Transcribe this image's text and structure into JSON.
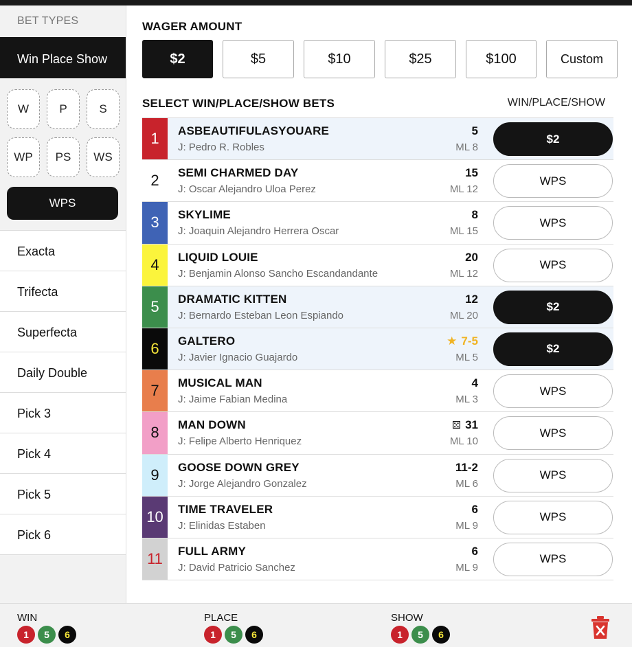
{
  "sidebar": {
    "header": "BET TYPES",
    "active": "Win Place Show",
    "sub_types": [
      "W",
      "P",
      "S",
      "WP",
      "PS",
      "WS"
    ],
    "sub_selected": "WPS",
    "items": [
      "Exacta",
      "Trifecta",
      "Superfecta",
      "Daily Double",
      "Pick 3",
      "Pick 4",
      "Pick 5",
      "Pick 6"
    ]
  },
  "wager": {
    "title": "WAGER AMOUNT",
    "options": [
      "$2",
      "$5",
      "$10",
      "$25",
      "$100",
      "Custom"
    ],
    "selected": "$2"
  },
  "selection": {
    "title": "SELECT WIN/PLACE/SHOW BETS",
    "column": "WIN/PLACE/SHOW"
  },
  "runners": [
    {
      "num": "1",
      "name": "ASBEAUTIFULASYOUARE",
      "jockey": "J: Pedro R. Robles",
      "odds": "5",
      "ml": "ML 8",
      "btn": "$2",
      "selected": true,
      "color": "#c8232c",
      "text": "#ffffff"
    },
    {
      "num": "2",
      "name": "SEMI CHARMED DAY",
      "jockey": "J: Oscar Alejandro Uloa Perez",
      "odds": "15",
      "ml": "ML 12",
      "btn": "WPS",
      "selected": false,
      "color": "#ffffff",
      "text": "#111111"
    },
    {
      "num": "3",
      "name": "SKYLIME",
      "jockey": "J: Joaquin Alejandro Herrera Oscar",
      "odds": "8",
      "ml": "ML 15",
      "btn": "WPS",
      "selected": false,
      "color": "#3f63b5",
      "text": "#ffffff"
    },
    {
      "num": "4",
      "name": "LIQUID LOUIE",
      "jockey": "J: Benjamin Alonso Sancho Escandandante",
      "odds": "20",
      "ml": "ML 12",
      "btn": "WPS",
      "selected": false,
      "color": "#fbf43c",
      "text": "#111111"
    },
    {
      "num": "5",
      "name": "DRAMATIC KITTEN",
      "jockey": "J: Bernardo Esteban Leon Espiando",
      "odds": "12",
      "ml": "ML 20",
      "btn": "$2",
      "selected": true,
      "color": "#3c8e4c",
      "text": "#ffffff"
    },
    {
      "num": "6",
      "name": "GALTERO",
      "jockey": "J: Javier Ignacio Guajardo",
      "odds": "7-5",
      "ml": "ML 5",
      "btn": "$2",
      "selected": true,
      "color": "#0a0a0a",
      "text": "#f7e63a",
      "favorite": true
    },
    {
      "num": "7",
      "name": "MUSICAL MAN",
      "jockey": "J: Jaime Fabian Medina",
      "odds": "4",
      "ml": "ML 3",
      "btn": "WPS",
      "selected": false,
      "color": "#e87e4c",
      "text": "#111111"
    },
    {
      "num": "8",
      "name": "MAN DOWN",
      "jockey": "J: Felipe Alberto Henriquez",
      "odds": "31",
      "ml": "ML 10",
      "btn": "WPS",
      "selected": false,
      "color": "#f29fc7",
      "text": "#111111",
      "dice": true
    },
    {
      "num": "9",
      "name": "GOOSE DOWN GREY",
      "jockey": "J: Jorge Alejandro Gonzalez",
      "odds": "11-2",
      "ml": "ML 6",
      "btn": "WPS",
      "selected": false,
      "color": "#cfeefb",
      "text": "#111111"
    },
    {
      "num": "10",
      "name": "TIME TRAVELER",
      "jockey": "J: Elinidas Estaben",
      "odds": "6",
      "ml": "ML 9",
      "btn": "WPS",
      "selected": false,
      "color": "#5a3a74",
      "text": "#ffffff"
    },
    {
      "num": "11",
      "name": "FULL ARMY",
      "jockey": "J: David Patricio Sanchez",
      "odds": "6",
      "ml": "ML 9",
      "btn": "WPS",
      "selected": false,
      "color": "#d2d2d2",
      "text": "#c8232c"
    }
  ],
  "footer": {
    "groups": [
      {
        "label": "WIN",
        "picks": [
          "1",
          "5",
          "6"
        ]
      },
      {
        "label": "PLACE",
        "picks": [
          "1",
          "5",
          "6"
        ]
      },
      {
        "label": "SHOW",
        "picks": [
          "1",
          "5",
          "6"
        ]
      }
    ],
    "chip_colors": {
      "1": "#c8232c",
      "5": "#3c8e4c",
      "6": "#0a0a0a"
    },
    "chip_text": {
      "1": "#ffffff",
      "5": "#ffffff",
      "6": "#f7e63a"
    },
    "trash_icon": "trash-icon",
    "accent": "#d9352f"
  }
}
